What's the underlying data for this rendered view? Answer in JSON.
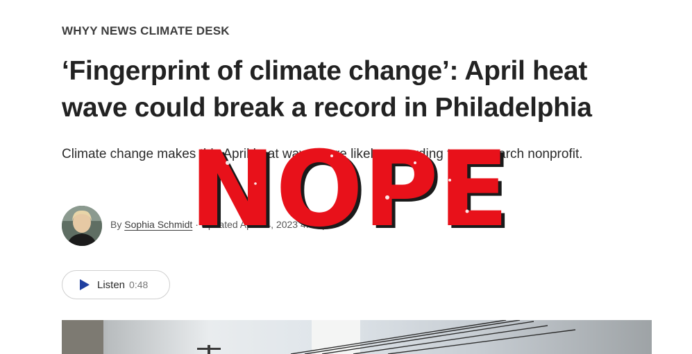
{
  "article": {
    "kicker": "WHYY NEWS CLIMATE DESK",
    "headline": "‘Fingerprint of climate change’: April heat wave could break a record in Philadelphia",
    "dek": "Climate change makes this April heat wave more likely, according to a research nonprofit.",
    "byline": {
      "prefix": "By",
      "author": "Sophia Schmidt",
      "updated": "· Updated Apr. 14, 2023 4:51 pm"
    },
    "listen": {
      "label": "Listen",
      "duration": "0:48"
    },
    "hero_image": "power-lines-photo"
  },
  "overlay": {
    "text": "NOPE",
    "color": "#e8111a",
    "shadow": "#1a1a1a"
  },
  "colors": {
    "accent": "#1f3fa0",
    "headline": "#222222"
  }
}
